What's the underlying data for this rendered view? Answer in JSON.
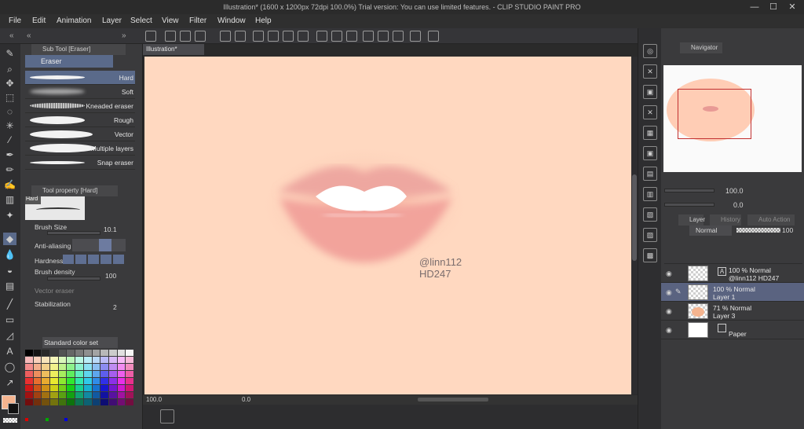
{
  "window": {
    "title": "Illustration* (1600 x 1200px 72dpi 100.0%)  Trial version: You can use limited features. - CLIP STUDIO PAINT PRO",
    "minimize": "—",
    "maximize": "☐",
    "close": "✕"
  },
  "menu": [
    "File",
    "Edit",
    "Animation",
    "Layer",
    "Select",
    "View",
    "Filter",
    "Window",
    "Help"
  ],
  "subtool": {
    "panel_title": "Sub Tool [Eraser]",
    "group": "Eraser",
    "brushes": [
      "Hard",
      "Soft",
      "Kneaded eraser",
      "Rough",
      "Vector",
      "Multiple layers",
      "Snap eraser"
    ],
    "selected": "Hard"
  },
  "tool_property": {
    "panel_title": "Tool property [Hard]",
    "preview_label": "Hard",
    "brush_size_label": "Brush Size",
    "brush_size_value": "10.1",
    "antialias_label": "Anti-aliasing",
    "hardness_label": "Hardness",
    "brush_density_label": "Brush density",
    "brush_density_value": "100",
    "vector_eraser_label": "Vector eraser",
    "stabilization_label": "Stabilization",
    "stabilization_value": "2"
  },
  "color_set": {
    "dropdown": "Standard color set"
  },
  "document": {
    "tab": "Illustration*",
    "watermark_line1": "@linn112",
    "watermark_line2": "HD247"
  },
  "status": {
    "zoom": "100.0",
    "rotation": "0.0"
  },
  "navigator": {
    "title": "Navigator",
    "zoom": "100.0",
    "rotation": "0.0"
  },
  "layer_panel": {
    "tabs": [
      "Layer",
      "History",
      "Auto Action"
    ],
    "blend_mode": "Normal",
    "opacity": "100",
    "layers": [
      {
        "line1": "100 % Normal",
        "line2": "@linn112 HD247",
        "selected": false
      },
      {
        "line1": "100 % Normal",
        "line2": "Layer 1",
        "selected": true
      },
      {
        "line1": "71 % Normal",
        "line2": "Layer 3",
        "selected": false
      },
      {
        "line1": "",
        "line2": "Paper",
        "selected": false
      }
    ]
  },
  "colors": {
    "accent": "#5a6a8a",
    "canvas": "#ffd8c0",
    "main_color": "#f5b48f"
  }
}
